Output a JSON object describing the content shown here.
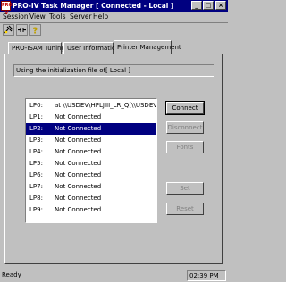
{
  "window": {
    "title": "PRO-IV Task Manager [ Connected -  Local ]",
    "controls": {
      "minimize": "_",
      "maximize": "□",
      "close": "×"
    },
    "app_icon_label": "PRO IV"
  },
  "menu": [
    "Session",
    "View",
    "Tools",
    "Server",
    "Help"
  ],
  "tabs": [
    "PRO-ISAM Tuning",
    "User Information",
    "Printer Management"
  ],
  "active_tab": "Printer Management",
  "init_file_text": "Using the initialization file of[ Local ]",
  "printers": [
    {
      "lp": "LP0:",
      "status": "at \\\\USDEV\\HPLJIII_LR_Q[\\\\USDEV\\"
    },
    {
      "lp": "LP1:",
      "status": "Not Connected"
    },
    {
      "lp": "LP2:",
      "status": "Not Connected",
      "selected": true
    },
    {
      "lp": "LP3:",
      "status": "Not Connected"
    },
    {
      "lp": "LP4:",
      "status": "Not Connected"
    },
    {
      "lp": "LP5:",
      "status": "Not Connected"
    },
    {
      "lp": "LP6:",
      "status": "Not Connected"
    },
    {
      "lp": "LP7:",
      "status": "Not Connected"
    },
    {
      "lp": "LP8:",
      "status": "Not Connected"
    },
    {
      "lp": "LP9:",
      "status": "Not Connected"
    }
  ],
  "buttons": {
    "connect": "Connect",
    "disconnect": "Disconnect",
    "fonts": "Fonts",
    "set": "Set",
    "reset": "Reset"
  },
  "statusbar": {
    "status": "Ready",
    "time": "02:39  PM"
  },
  "colors": {
    "titlebar": "#000080",
    "selection": "#000080",
    "face": "#c0c0c0"
  }
}
